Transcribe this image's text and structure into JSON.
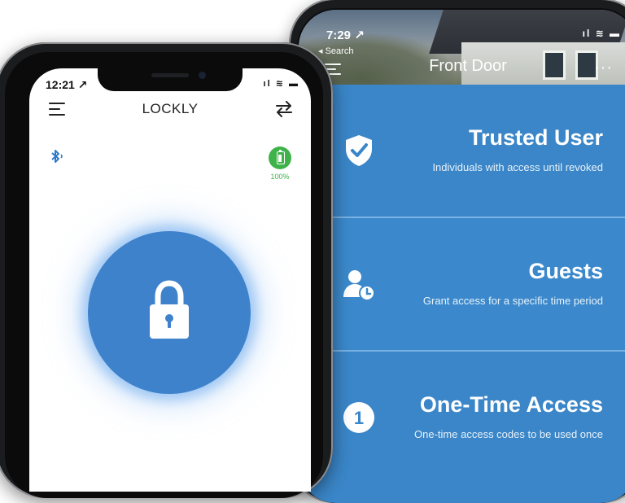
{
  "back_phone": {
    "status": {
      "time": "7:29 ↗",
      "icons": "ıl ≋ ▬"
    },
    "back_link": "◂ Search",
    "title": "Front Door",
    "more": "···",
    "menu": [
      {
        "title": "Trusted User",
        "subtitle": "Individuals with access until revoked",
        "icon": "shield-check-icon"
      },
      {
        "title": "Guests",
        "subtitle": "Grant access for a specific time period",
        "icon": "user-clock-icon"
      },
      {
        "title": "One-Time Access",
        "subtitle": "One-time access codes to be used once",
        "icon": "one-time-icon",
        "icon_text": "1"
      }
    ]
  },
  "front_phone": {
    "status": {
      "time": "12:21 ↗",
      "icons": "ıl ≋ ▬"
    },
    "title": "LOCKLY",
    "battery_percent": "100%",
    "colors": {
      "accent_blue": "#3f82cc",
      "battery_green": "#3fb24a"
    }
  }
}
